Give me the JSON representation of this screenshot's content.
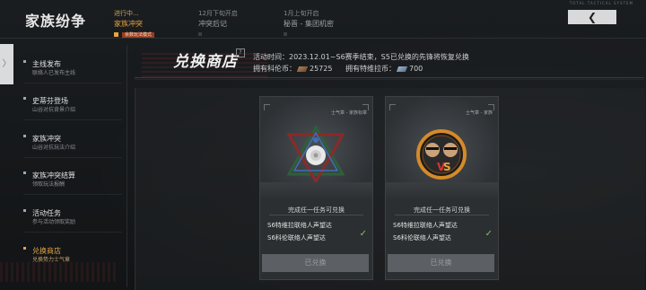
{
  "app": {
    "title": "家族纷争"
  },
  "corner_text": "TOTAL TACTICAL SYSTEM",
  "phases": [
    {
      "status": "进行中...",
      "name": "家族冲突"
    },
    {
      "status": "12月下旬开启",
      "name": "冲突后记"
    },
    {
      "status": "1月上旬开启",
      "name": "秘晋 - 集团机密"
    }
  ],
  "active_tag": "余数玩法模式",
  "back_button": {
    "label": "❮"
  },
  "sidebar": {
    "handle": "〉",
    "items": [
      {
        "title": "主线发布",
        "subtitle": "联络人已发布主线"
      },
      {
        "title": "史蒂芬登场",
        "subtitle": "山谷对抗背景介绍"
      },
      {
        "title": "家族冲突",
        "subtitle": "山谷对抗玩法介绍"
      },
      {
        "title": "家族冲突结算",
        "subtitle": "领取玩法报酬"
      },
      {
        "title": "活动任务",
        "subtitle": "参与活动领取奖励"
      },
      {
        "title": "兑换商店",
        "subtitle": "兑换势力士气章"
      }
    ]
  },
  "shop": {
    "title": "兑换商店",
    "help": "?",
    "activity": "活动时间：2023.12.01~S6赛季结束，S5已兑换的先锋将恢复兑换",
    "currencies": [
      {
        "label": "拥有科伦币：",
        "value": "25725",
        "icon": "keluen-coin-icon",
        "color": "#b08055"
      },
      {
        "label": "拥有特维拉币：",
        "value": "700",
        "icon": "teweila-coin-icon",
        "color": "#9bb7cf"
      }
    ]
  },
  "cards": [
    {
      "tag": "士气章 - 家族标章",
      "emblem": "rose-star-emblem-icon",
      "requirement": "完成任一任务可兑换",
      "tasks": [
        "S6特维拉联络人声望达",
        "S6科伦联络人声望达"
      ],
      "redeem_label": "已兑换"
    },
    {
      "tag": "士气章 - 家族",
      "emblem": "versus-duel-emblem-icon",
      "requirement": "完成任一任务可兑换",
      "tasks": [
        "S6特维拉联络人声望达",
        "S6科伦联络人声望达"
      ],
      "redeem_label": "已兑换"
    }
  ],
  "colors": {
    "accent": "#e8a440",
    "check": "#7fc25b",
    "back_button_bg": "#d7d9da"
  }
}
